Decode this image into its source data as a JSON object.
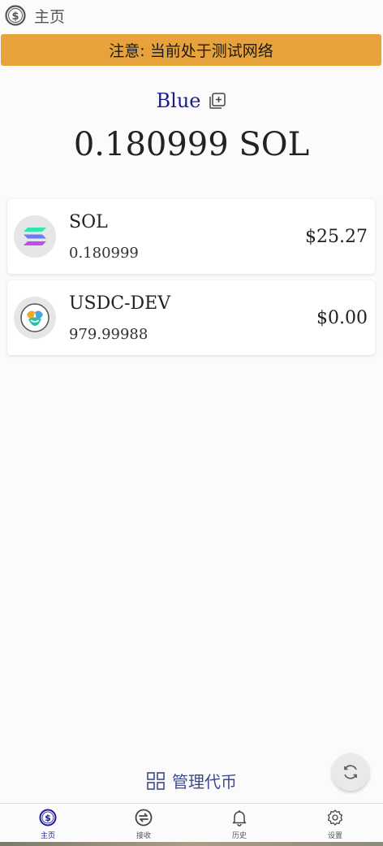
{
  "header": {
    "title": "主页",
    "icon": "dollar-coin-icon"
  },
  "banner": {
    "text": "注意: 当前处于测试网络"
  },
  "account": {
    "name": "Blue",
    "copy_icon": "copy-icon",
    "balance": "0.180999 SOL"
  },
  "tokens": [
    {
      "symbol": "SOL",
      "amount": "0.180999",
      "usd": "$25.27",
      "icon": "solana-logo-icon"
    },
    {
      "symbol": "USDC-DEV",
      "amount": "979.99988",
      "usd": "$0.00",
      "icon": "usdc-dev-logo-icon"
    }
  ],
  "manage": {
    "label": "管理代币",
    "icon": "grid-icon"
  },
  "refresh": {
    "icon": "refresh-icon"
  },
  "nav": {
    "items": [
      {
        "label": "主页",
        "icon": "dollar-coin-icon",
        "active": true
      },
      {
        "label": "接收",
        "icon": "swap-icon",
        "active": false
      },
      {
        "label": "历史",
        "icon": "bell-icon",
        "active": false
      },
      {
        "label": "设置",
        "icon": "gear-icon",
        "active": false
      }
    ]
  },
  "colors": {
    "banner": "#e8a23c",
    "accent": "#1d1d8a",
    "manage": "#3d4a8f"
  }
}
